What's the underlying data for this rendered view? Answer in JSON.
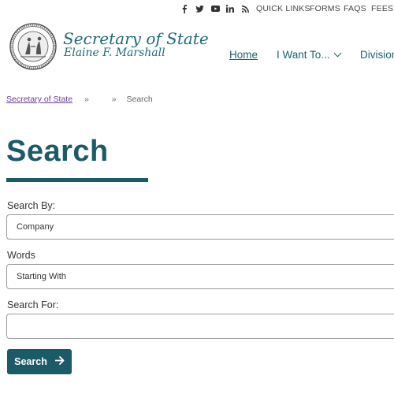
{
  "utility": {
    "social_icons": [
      "facebook-icon",
      "twitter-icon",
      "youtube-icon",
      "linkedin-icon",
      "rss-icon"
    ],
    "links": [
      "QUICK LINKS",
      "FORMS",
      "FAQS",
      "FEES"
    ]
  },
  "header": {
    "title": "Secretary of State",
    "subtitle": "Elaine F. Marshall"
  },
  "nav": {
    "home": "Home",
    "i_want_to": "I Want To...",
    "divisions": "Division"
  },
  "breadcrumb": {
    "home": "Secretary of State",
    "sep": "»",
    "current": "Search"
  },
  "page": {
    "title": "Search"
  },
  "form": {
    "search_by_label": "Search By:",
    "search_by_value": "Company",
    "words_label": "Words",
    "words_value": "Starting With",
    "search_for_label": "Search For:",
    "search_for_value": "",
    "submit_label": "Search"
  },
  "colors": {
    "brand_teal": "#1c5a67",
    "link_purple": "#6b3f8f"
  }
}
